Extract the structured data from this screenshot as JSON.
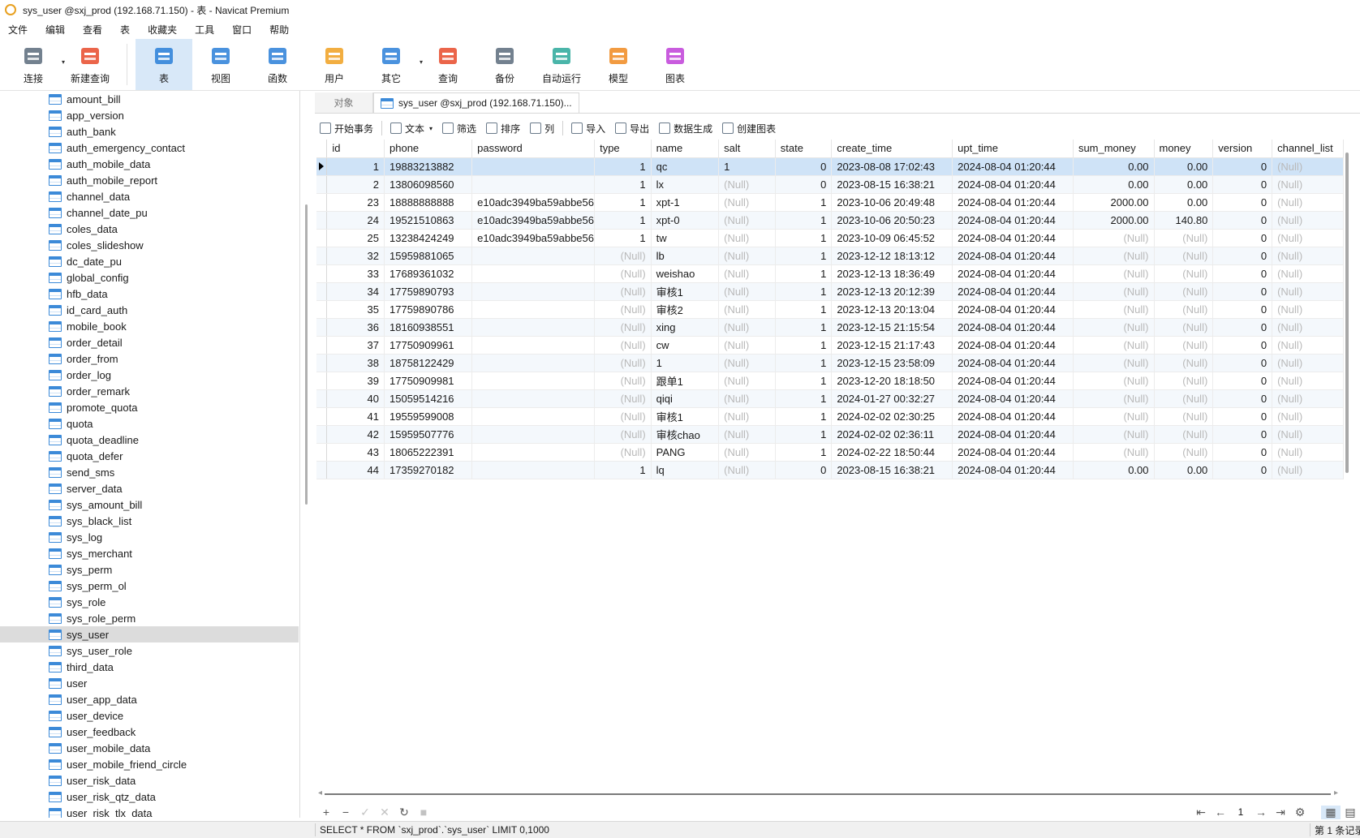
{
  "window": {
    "title": "sys_user @sxj_prod (192.168.71.150) - 表 - Navicat Premium"
  },
  "menu": [
    "文件",
    "编辑",
    "查看",
    "表",
    "收藏夹",
    "工具",
    "窗口",
    "帮助"
  ],
  "toolbar": [
    {
      "label": "连接",
      "icon": "plug-icon",
      "color": "#5a6b7b",
      "caret": true
    },
    {
      "label": "新建查询",
      "icon": "new-query-icon",
      "color": "#e84a2a"
    },
    {
      "label": "表",
      "icon": "table-icon",
      "color": "#2a7fd8",
      "active": true
    },
    {
      "label": "视图",
      "icon": "view-icon",
      "color": "#2a7fd8"
    },
    {
      "label": "函数",
      "icon": "function-icon",
      "color": "#2a7fd8"
    },
    {
      "label": "用户",
      "icon": "user-icon",
      "color": "#f0a020"
    },
    {
      "label": "其它",
      "icon": "tools-icon",
      "color": "#2a7fd8",
      "caret": true
    },
    {
      "label": "查询",
      "icon": "query-icon",
      "color": "#e84a2a"
    },
    {
      "label": "备份",
      "icon": "backup-icon",
      "color": "#5a6b7b"
    },
    {
      "label": "自动运行",
      "icon": "robot-icon",
      "color": "#2aa89a"
    },
    {
      "label": "模型",
      "icon": "model-icon",
      "color": "#f08a20"
    },
    {
      "label": "图表",
      "icon": "chart-icon",
      "color": "#c040d8"
    }
  ],
  "sidebar": {
    "items": [
      "amount_bill",
      "app_version",
      "auth_bank",
      "auth_emergency_contact",
      "auth_mobile_data",
      "auth_mobile_report",
      "channel_data",
      "channel_date_pu",
      "coles_data",
      "coles_slideshow",
      "dc_date_pu",
      "global_config",
      "hfb_data",
      "id_card_auth",
      "mobile_book",
      "order_detail",
      "order_from",
      "order_log",
      "order_remark",
      "promote_quota",
      "quota",
      "quota_deadline",
      "quota_defer",
      "send_sms",
      "server_data",
      "sys_amount_bill",
      "sys_black_list",
      "sys_log",
      "sys_merchant",
      "sys_perm",
      "sys_perm_ol",
      "sys_role",
      "sys_role_perm",
      "sys_user",
      "sys_user_role",
      "third_data",
      "user",
      "user_app_data",
      "user_device",
      "user_feedback",
      "user_mobile_data",
      "user_mobile_friend_circle",
      "user_risk_data",
      "user_risk_qtz_data",
      "user_risk_tlx_data"
    ],
    "selected": "sys_user"
  },
  "tabs": {
    "objects": "对象",
    "current": "sys_user @sxj_prod (192.168.71.150)..."
  },
  "grid_toolbar": [
    {
      "label": "开始事务",
      "icon": "transaction-icon"
    },
    {
      "label": "文本",
      "icon": "text-icon",
      "caret": true
    },
    {
      "label": "筛选",
      "icon": "filter-icon"
    },
    {
      "label": "排序",
      "icon": "sort-icon"
    },
    {
      "label": "列",
      "icon": "columns-icon"
    },
    {
      "label": "导入",
      "icon": "import-icon"
    },
    {
      "label": "导出",
      "icon": "export-icon"
    },
    {
      "label": "数据生成",
      "icon": "data-gen-icon"
    },
    {
      "label": "创建图表",
      "icon": "create-chart-icon"
    }
  ],
  "table": {
    "columns": [
      "id",
      "phone",
      "password",
      "type",
      "name",
      "salt",
      "state",
      "create_time",
      "upt_time",
      "sum_money",
      "money",
      "version",
      "channel_list"
    ],
    "rows": [
      [
        "1",
        "19883213882",
        "",
        "1",
        "qc",
        "1",
        "0",
        "2023-08-08 17:02:43",
        "2024-08-04 01:20:44",
        "0.00",
        "0.00",
        "0",
        "(Null)"
      ],
      [
        "2",
        "13806098560",
        "",
        "1",
        "lx",
        "(Null)",
        "0",
        "2023-08-15 16:38:21",
        "2024-08-04 01:20:44",
        "0.00",
        "0.00",
        "0",
        "(Null)"
      ],
      [
        "23",
        "18888888888",
        "e10adc3949ba59abbe56",
        "1",
        "xpt-1",
        "(Null)",
        "1",
        "2023-10-06 20:49:48",
        "2024-08-04 01:20:44",
        "2000.00",
        "0.00",
        "0",
        "(Null)"
      ],
      [
        "24",
        "19521510863",
        "e10adc3949ba59abbe56",
        "1",
        "xpt-0",
        "(Null)",
        "1",
        "2023-10-06 20:50:23",
        "2024-08-04 01:20:44",
        "2000.00",
        "140.80",
        "0",
        "(Null)"
      ],
      [
        "25",
        "13238424249",
        "e10adc3949ba59abbe56",
        "1",
        "tw",
        "(Null)",
        "1",
        "2023-10-09 06:45:52",
        "2024-08-04 01:20:44",
        "(Null)",
        "(Null)",
        "0",
        "(Null)"
      ],
      [
        "32",
        "15959881065",
        "",
        "(Null)",
        "lb",
        "(Null)",
        "1",
        "2023-12-12 18:13:12",
        "2024-08-04 01:20:44",
        "(Null)",
        "(Null)",
        "0",
        "(Null)"
      ],
      [
        "33",
        "17689361032",
        "",
        "(Null)",
        "weishao",
        "(Null)",
        "1",
        "2023-12-13 18:36:49",
        "2024-08-04 01:20:44",
        "(Null)",
        "(Null)",
        "0",
        "(Null)"
      ],
      [
        "34",
        "17759890793",
        "",
        "(Null)",
        "审核1",
        "(Null)",
        "1",
        "2023-12-13 20:12:39",
        "2024-08-04 01:20:44",
        "(Null)",
        "(Null)",
        "0",
        "(Null)"
      ],
      [
        "35",
        "17759890786",
        "",
        "(Null)",
        "审核2",
        "(Null)",
        "1",
        "2023-12-13 20:13:04",
        "2024-08-04 01:20:44",
        "(Null)",
        "(Null)",
        "0",
        "(Null)"
      ],
      [
        "36",
        "18160938551",
        "",
        "(Null)",
        "xing",
        "(Null)",
        "1",
        "2023-12-15 21:15:54",
        "2024-08-04 01:20:44",
        "(Null)",
        "(Null)",
        "0",
        "(Null)"
      ],
      [
        "37",
        "17750909961",
        "",
        "(Null)",
        "cw",
        "(Null)",
        "1",
        "2023-12-15 21:17:43",
        "2024-08-04 01:20:44",
        "(Null)",
        "(Null)",
        "0",
        "(Null)"
      ],
      [
        "38",
        "18758122429",
        "",
        "(Null)",
        "1",
        "(Null)",
        "1",
        "2023-12-15 23:58:09",
        "2024-08-04 01:20:44",
        "(Null)",
        "(Null)",
        "0",
        "(Null)"
      ],
      [
        "39",
        "17750909981",
        "",
        "(Null)",
        "跟单1",
        "(Null)",
        "1",
        "2023-12-20 18:18:50",
        "2024-08-04 01:20:44",
        "(Null)",
        "(Null)",
        "0",
        "(Null)"
      ],
      [
        "40",
        "15059514216",
        "",
        "(Null)",
        "qiqi",
        "(Null)",
        "1",
        "2024-01-27 00:32:27",
        "2024-08-04 01:20:44",
        "(Null)",
        "(Null)",
        "0",
        "(Null)"
      ],
      [
        "41",
        "19559599008",
        "",
        "(Null)",
        "审核1",
        "(Null)",
        "1",
        "2024-02-02 02:30:25",
        "2024-08-04 01:20:44",
        "(Null)",
        "(Null)",
        "0",
        "(Null)"
      ],
      [
        "42",
        "15959507776",
        "",
        "(Null)",
        "审核chao",
        "(Null)",
        "1",
        "2024-02-02 02:36:11",
        "2024-08-04 01:20:44",
        "(Null)",
        "(Null)",
        "0",
        "(Null)"
      ],
      [
        "43",
        "18065222391",
        "",
        "(Null)",
        "PANG",
        "(Null)",
        "1",
        "2024-02-22 18:50:44",
        "2024-08-04 01:20:44",
        "(Null)",
        "(Null)",
        "0",
        "(Null)"
      ],
      [
        "44",
        "17359270182",
        "",
        "1",
        "lq",
        "(Null)",
        "0",
        "2023-08-15 16:38:21",
        "2024-08-04 01:20:44",
        "0.00",
        "0.00",
        "0",
        "(Null)"
      ]
    ],
    "selected_row": 0
  },
  "nav": {
    "page": "1"
  },
  "status": {
    "sql": "SELECT * FROM `sxj_prod`.`sys_user` LIMIT 0,1000",
    "record": "第 1 条记录"
  }
}
